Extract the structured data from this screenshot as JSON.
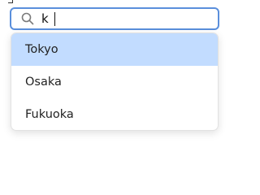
{
  "search": {
    "value": "k"
  },
  "icons": {
    "search": "search-icon"
  },
  "colors": {
    "focus_border": "#5a8fdc",
    "highlight": "#c2dcff"
  },
  "suggestions": {
    "items": [
      {
        "label": "Tokyo",
        "highlighted": true
      },
      {
        "label": "Osaka",
        "highlighted": false
      },
      {
        "label": "Fukuoka",
        "highlighted": false
      }
    ]
  }
}
